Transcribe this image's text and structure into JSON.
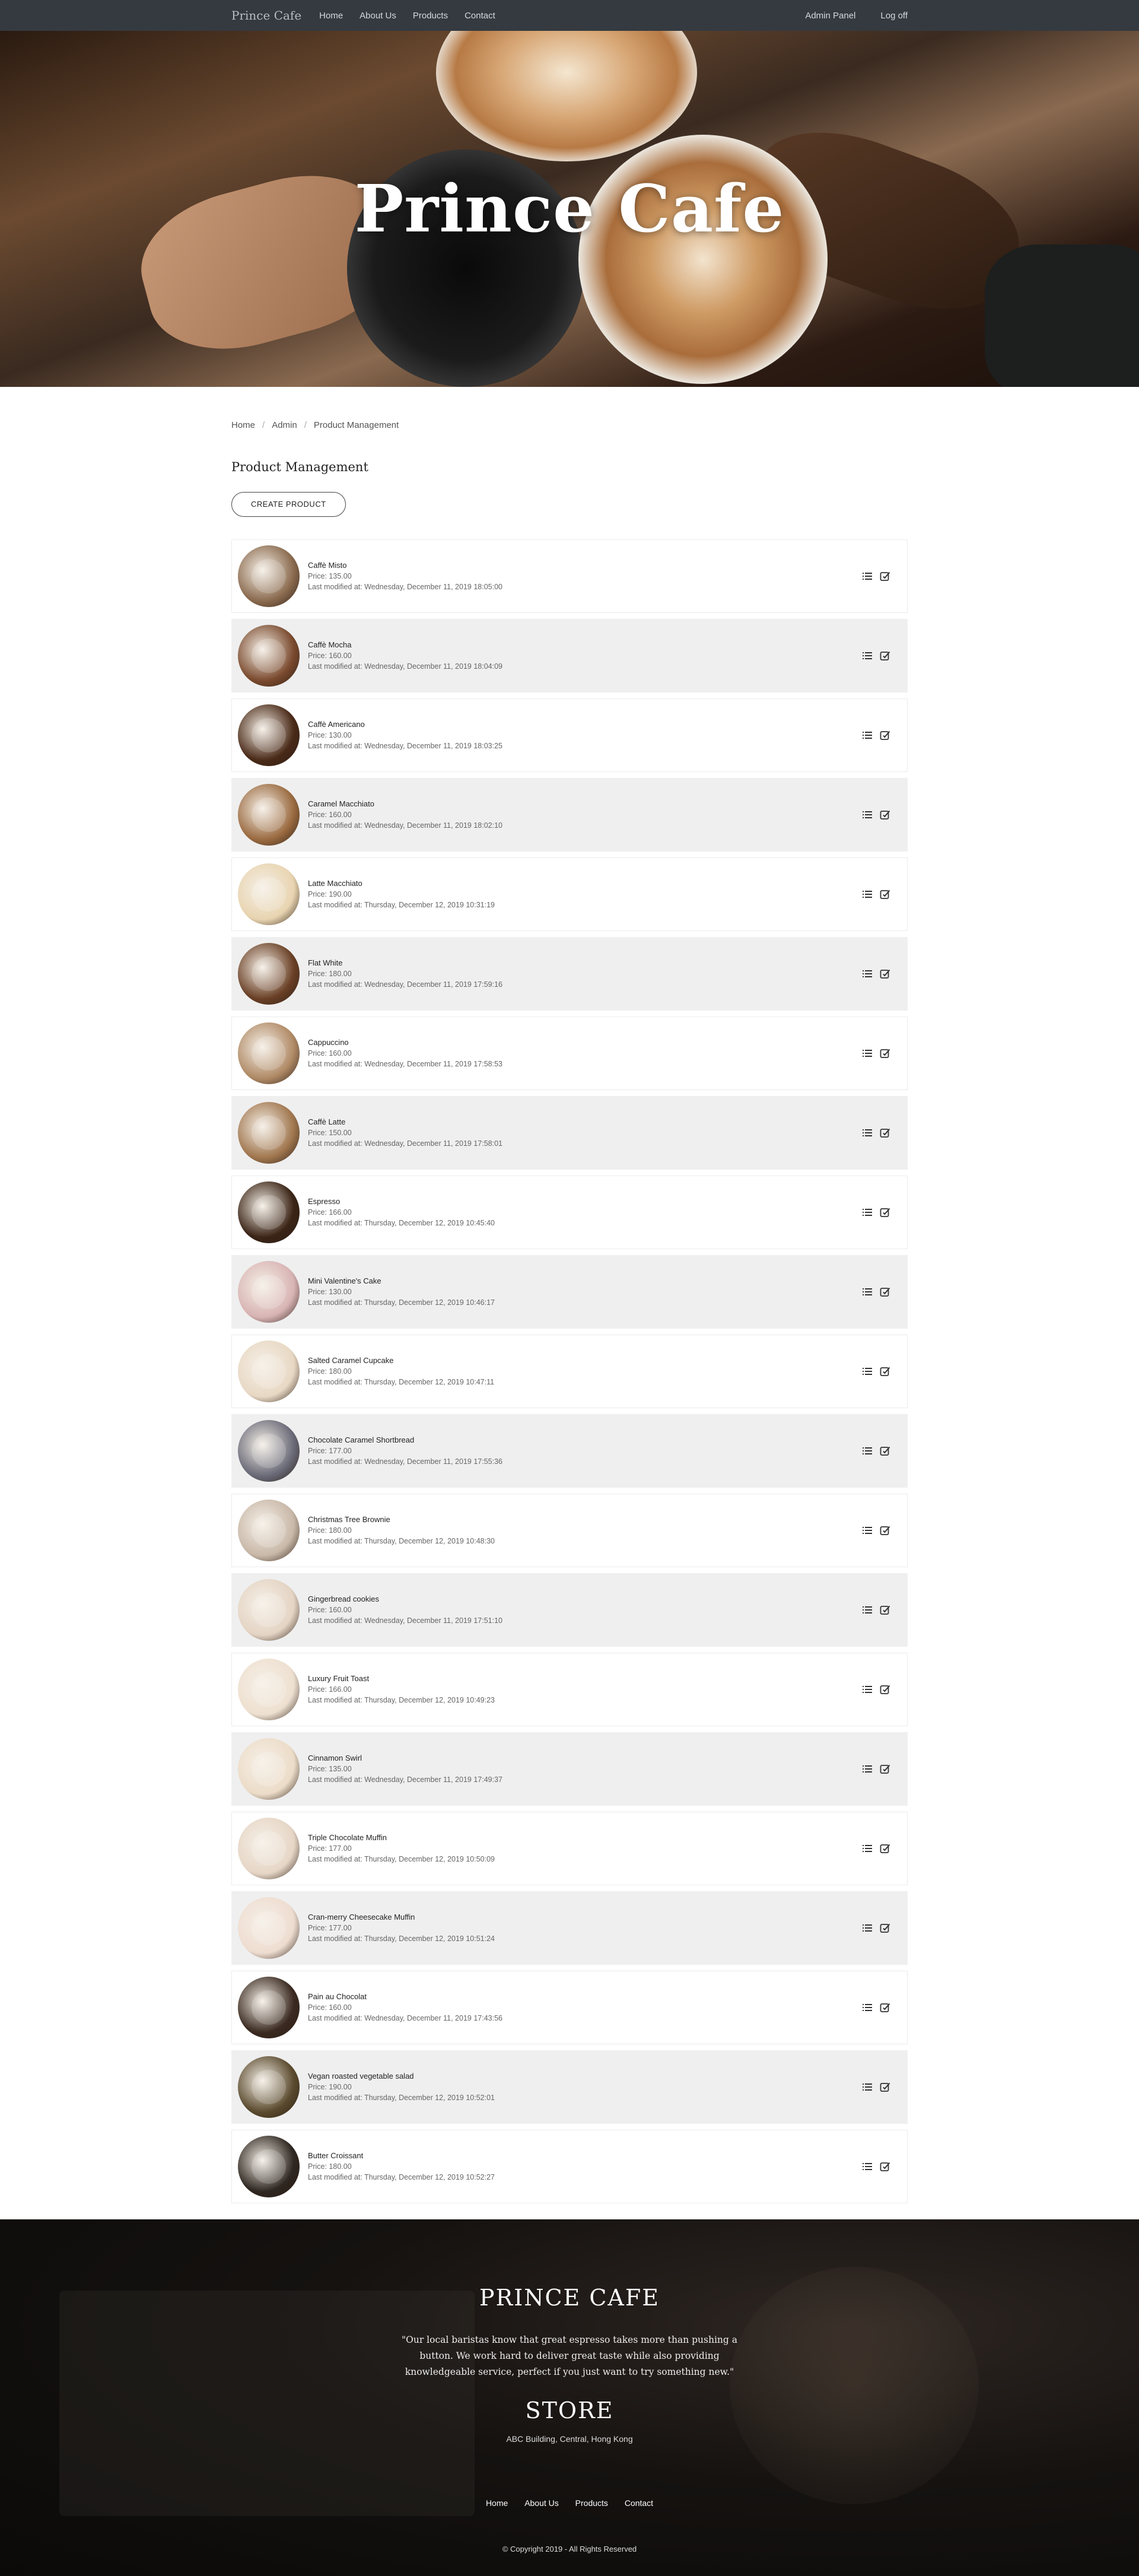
{
  "navbar": {
    "brand": "Prince Cafe",
    "links": [
      "Home",
      "About Us",
      "Products",
      "Contact"
    ],
    "right_links": [
      "Admin Panel",
      "Log off"
    ]
  },
  "hero": {
    "title": "Prince Cafe"
  },
  "breadcrumb": [
    "Home",
    "Admin",
    "Product Management"
  ],
  "page_title": "Product Management",
  "create_button": "CREATE PRODUCT",
  "products": [
    {
      "name": "Caffè Misto",
      "price": "Price: 135.00",
      "modified": "Last modified at: Wednesday, December 11, 2019 18:05:00",
      "color": "#8a6a4e"
    },
    {
      "name": "Caffè Mocha",
      "price": "Price: 160.00",
      "modified": "Last modified at: Wednesday, December 11, 2019 18:04:09",
      "color": "#7a4a2e"
    },
    {
      "name": "Caffè Americano",
      "price": "Price: 130.00",
      "modified": "Last modified at: Wednesday, December 11, 2019 18:03:25",
      "color": "#4a2a18"
    },
    {
      "name": "Caramel Macchiato",
      "price": "Price: 160.00",
      "modified": "Last modified at: Wednesday, December 11, 2019 18:02:10",
      "color": "#9a6a40"
    },
    {
      "name": "Latte Macchiato",
      "price": "Price: 190.00",
      "modified": "Last modified at: Thursday, December 12, 2019 10:31:19",
      "color": "#e8d4b0"
    },
    {
      "name": "Flat White",
      "price": "Price: 180.00",
      "modified": "Last modified at: Wednesday, December 11, 2019 17:59:16",
      "color": "#6a4026"
    },
    {
      "name": "Cappuccino",
      "price": "Price: 160.00",
      "modified": "Last modified at: Wednesday, December 11, 2019 17:58:53",
      "color": "#b08a66"
    },
    {
      "name": "Caffè Latte",
      "price": "Price: 150.00",
      "modified": "Last modified at: Wednesday, December 11, 2019 17:58:01",
      "color": "#a0764e"
    },
    {
      "name": "Espresso",
      "price": "Price: 166.00",
      "modified": "Last modified at: Thursday, December 12, 2019 10:45:40",
      "color": "#3a2416"
    },
    {
      "name": "Mini Valentine's Cake",
      "price": "Price: 130.00",
      "modified": "Last modified at: Thursday, December 12, 2019 10:46:17",
      "color": "#d8b4b4"
    },
    {
      "name": "Salted Caramel Cupcake",
      "price": "Price: 180.00",
      "modified": "Last modified at: Thursday, December 12, 2019 10:47:11",
      "color": "#e8d8c4"
    },
    {
      "name": "Chocolate Caramel Shortbread",
      "price": "Price: 177.00",
      "modified": "Last modified at: Wednesday, December 11, 2019 17:55:36",
      "color": "#6a6a78"
    },
    {
      "name": "Christmas Tree Brownie",
      "price": "Price: 180.00",
      "modified": "Last modified at: Thursday, December 12, 2019 10:48:30",
      "color": "#c8b8a8"
    },
    {
      "name": "Gingerbread cookies",
      "price": "Price: 160.00",
      "modified": "Last modified at: Wednesday, December 11, 2019 17:51:10",
      "color": "#e4d4c4"
    },
    {
      "name": "Luxury Fruit Toast",
      "price": "Price: 166.00",
      "modified": "Last modified at: Thursday, December 12, 2019 10:49:23",
      "color": "#eee0d0"
    },
    {
      "name": "Cinnamon Swirl",
      "price": "Price: 135.00",
      "modified": "Last modified at: Wednesday, December 11, 2019 17:49:37",
      "color": "#ecdcc8"
    },
    {
      "name": "Triple Chocolate Muffin",
      "price": "Price: 177.00",
      "modified": "Last modified at: Thursday, December 12, 2019 10:50:09",
      "color": "#e6d6c6"
    },
    {
      "name": "Cran-merry Cheesecake Muffin",
      "price": "Price: 177.00",
      "modified": "Last modified at: Thursday, December 12, 2019 10:51:24",
      "color": "#eedcd0"
    },
    {
      "name": "Pain au Chocolat",
      "price": "Price: 160.00",
      "modified": "Last modified at: Wednesday, December 11, 2019 17:43:56",
      "color": "#3a2a20"
    },
    {
      "name": "Vegan roasted vegetable salad",
      "price": "Price: 190.00",
      "modified": "Last modified at: Thursday, December 12, 2019 10:52:01",
      "color": "#5a4a2e"
    },
    {
      "name": "Butter Croissant",
      "price": "Price: 180.00",
      "modified": "Last modified at: Thursday, December 12, 2019 10:52:27",
      "color": "#2e2620"
    }
  ],
  "footer": {
    "title": "PRINCE CAFE",
    "quote": "\"Our local baristas know that great espresso takes more than pushing a button. We work hard to deliver great taste while also providing knowledgeable service, perfect if you just want to try something new.\"",
    "store_title": "STORE",
    "address": "ABC Building, Central, Hong Kong",
    "links": [
      "Home",
      "About Us",
      "Products",
      "Contact"
    ],
    "copyright": "© Copyright 2019 - All Rights Reserved"
  }
}
